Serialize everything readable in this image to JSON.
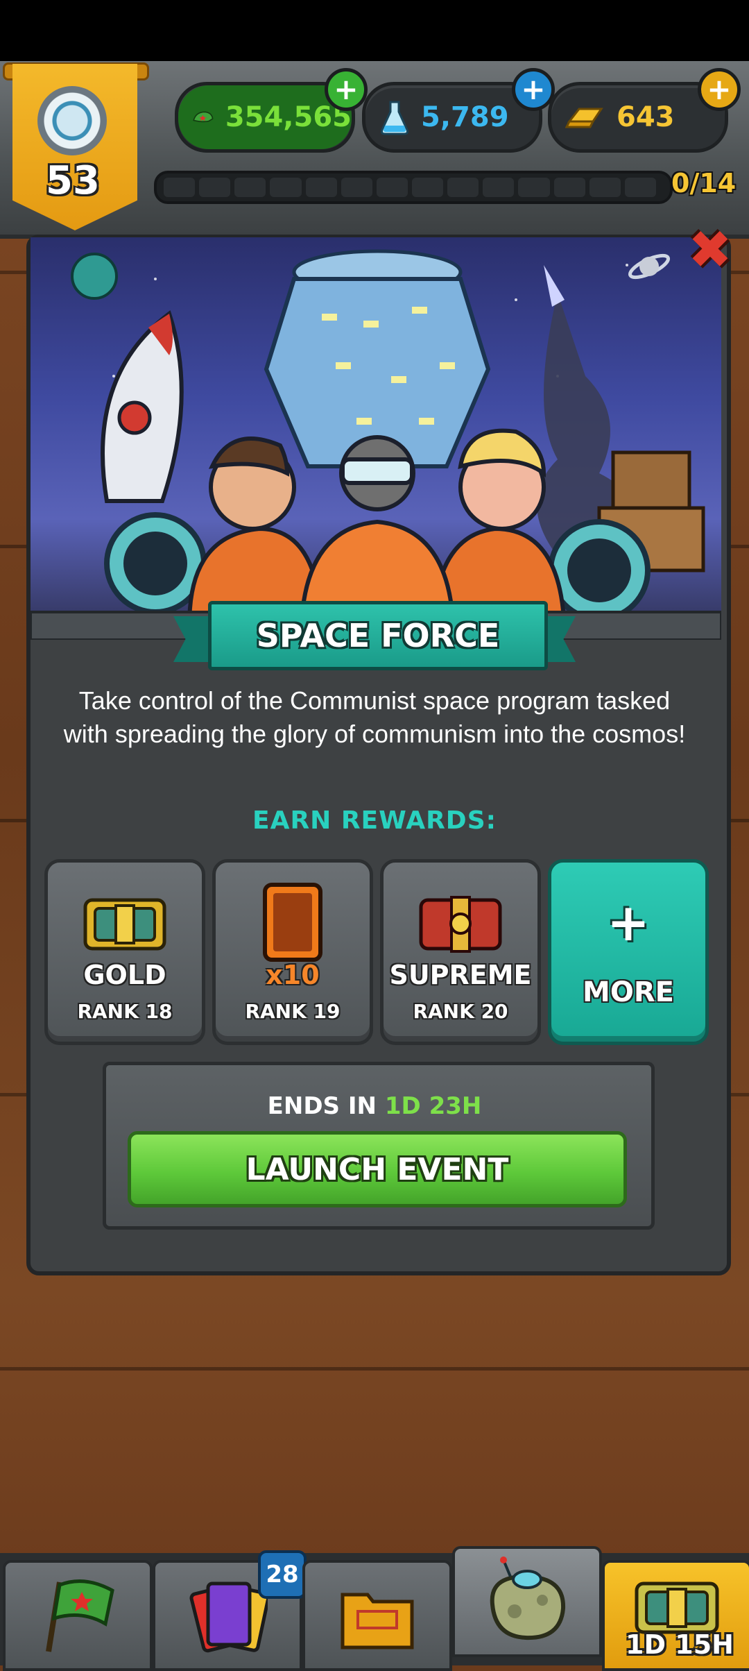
{
  "header": {
    "level": "53",
    "progress_text": "0/14",
    "progress_fraction": 0,
    "currencies": [
      {
        "name": "cash",
        "value": "354,565",
        "color": "#7ae03a"
      },
      {
        "name": "science",
        "value": "5,789",
        "color": "#3cb8f0"
      },
      {
        "name": "gold",
        "value": "643",
        "color": "#f6c534"
      }
    ]
  },
  "event": {
    "title": "SPACE FORCE",
    "description": "Take control of the Communist space program tasked with spreading the glory of communism into the cosmos!",
    "earn_rewards_label": "EARN REWARDS:",
    "rewards": [
      {
        "label": "GOLD",
        "rank": "RANK 18",
        "icon": "gold-chest-icon"
      },
      {
        "label": "x10",
        "rank": "RANK 19",
        "icon": "card-pack-icon"
      },
      {
        "label": "SUPREME",
        "rank": "RANK 20",
        "icon": "supreme-chest-icon"
      }
    ],
    "more_label": "MORE",
    "ends_in_label": "ENDS IN",
    "ends_days": "1D",
    "ends_hours": "23H",
    "launch_label": "LAUNCH EVENT"
  },
  "nav": {
    "items": [
      "flag-icon",
      "cards-icon",
      "folder-icon",
      "asteroid-icon",
      "chest-icon"
    ],
    "cards_badge": "28",
    "chest_timer": "1D 15H"
  },
  "colors": {
    "accent_teal": "#29d1bf",
    "launch_green": "#5ec93a",
    "close_red": "#e03a2e"
  }
}
